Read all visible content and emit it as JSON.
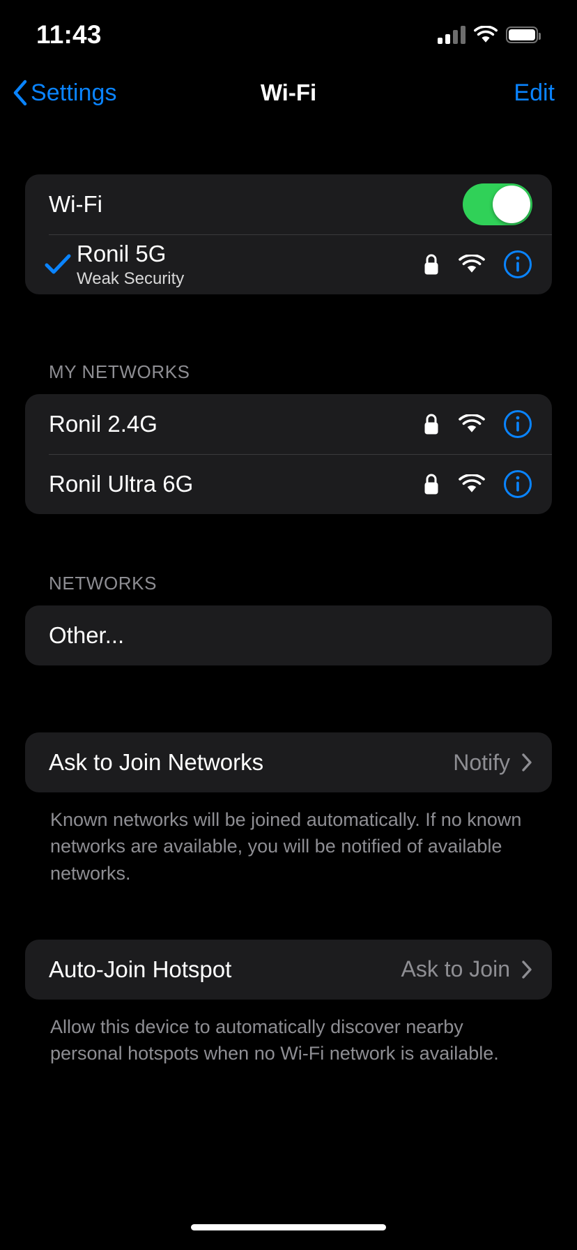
{
  "status_bar": {
    "time": "11:43",
    "cellular_bars_filled": 2,
    "cellular_bars_total": 4,
    "wifi_icon": "wifi-icon",
    "battery_icon": "battery-icon",
    "battery_level_percent": 92
  },
  "nav": {
    "back_label": "Settings",
    "title": "Wi-Fi",
    "edit_label": "Edit"
  },
  "wifi_toggle": {
    "label": "Wi-Fi",
    "state": "on",
    "accent_color": "#30d158"
  },
  "connected_network": {
    "name": "Ronil 5G",
    "subtitle": "Weak Security",
    "checkmark_icon": "checkmark-icon",
    "lock_icon": "lock-icon",
    "signal_icon": "wifi-icon",
    "info_icon": "info-circle-icon"
  },
  "my_networks": {
    "header": "MY NETWORKS",
    "items": [
      {
        "name": "Ronil 2.4G",
        "lock_icon": "lock-icon",
        "signal_icon": "wifi-icon",
        "info_icon": "info-circle-icon"
      },
      {
        "name": "Ronil Ultra 6G",
        "lock_icon": "lock-icon",
        "signal_icon": "wifi-icon",
        "info_icon": "info-circle-icon"
      }
    ]
  },
  "networks": {
    "header": "NETWORKS",
    "other_label": "Other..."
  },
  "ask_to_join": {
    "label": "Ask to Join Networks",
    "value": "Notify",
    "chevron_icon": "chevron-right-icon",
    "footnote": "Known networks will be joined automatically. If no known networks are available, you will be notified of available networks."
  },
  "auto_join_hotspot": {
    "label": "Auto-Join Hotspot",
    "value": "Ask to Join",
    "chevron_icon": "chevron-right-icon",
    "footnote": "Allow this device to automatically discover nearby personal hotspots when no Wi-Fi network is available."
  },
  "colors": {
    "accent_blue": "#0a84ff",
    "toggle_green": "#30d158",
    "group_bg": "#1c1c1e",
    "secondary_text": "#8e8e93"
  }
}
